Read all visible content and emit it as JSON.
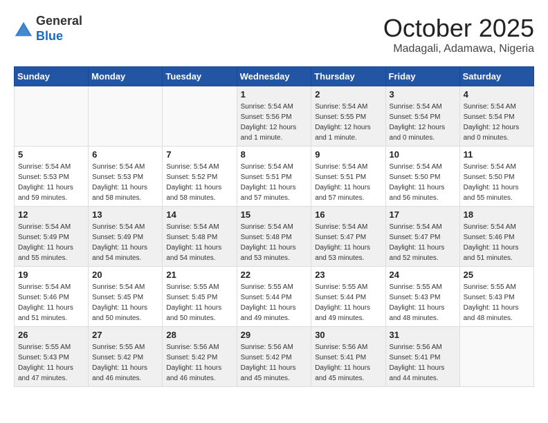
{
  "header": {
    "logo_general": "General",
    "logo_blue": "Blue",
    "month_title": "October 2025",
    "location": "Madagali, Adamawa, Nigeria"
  },
  "days_of_week": [
    "Sunday",
    "Monday",
    "Tuesday",
    "Wednesday",
    "Thursday",
    "Friday",
    "Saturday"
  ],
  "weeks": [
    [
      {
        "num": "",
        "info": "",
        "empty": true
      },
      {
        "num": "",
        "info": "",
        "empty": true
      },
      {
        "num": "",
        "info": "",
        "empty": true
      },
      {
        "num": "1",
        "info": "Sunrise: 5:54 AM\nSunset: 5:56 PM\nDaylight: 12 hours\nand 1 minute."
      },
      {
        "num": "2",
        "info": "Sunrise: 5:54 AM\nSunset: 5:55 PM\nDaylight: 12 hours\nand 1 minute."
      },
      {
        "num": "3",
        "info": "Sunrise: 5:54 AM\nSunset: 5:54 PM\nDaylight: 12 hours\nand 0 minutes."
      },
      {
        "num": "4",
        "info": "Sunrise: 5:54 AM\nSunset: 5:54 PM\nDaylight: 12 hours\nand 0 minutes."
      }
    ],
    [
      {
        "num": "5",
        "info": "Sunrise: 5:54 AM\nSunset: 5:53 PM\nDaylight: 11 hours\nand 59 minutes."
      },
      {
        "num": "6",
        "info": "Sunrise: 5:54 AM\nSunset: 5:53 PM\nDaylight: 11 hours\nand 58 minutes."
      },
      {
        "num": "7",
        "info": "Sunrise: 5:54 AM\nSunset: 5:52 PM\nDaylight: 11 hours\nand 58 minutes."
      },
      {
        "num": "8",
        "info": "Sunrise: 5:54 AM\nSunset: 5:51 PM\nDaylight: 11 hours\nand 57 minutes."
      },
      {
        "num": "9",
        "info": "Sunrise: 5:54 AM\nSunset: 5:51 PM\nDaylight: 11 hours\nand 57 minutes."
      },
      {
        "num": "10",
        "info": "Sunrise: 5:54 AM\nSunset: 5:50 PM\nDaylight: 11 hours\nand 56 minutes."
      },
      {
        "num": "11",
        "info": "Sunrise: 5:54 AM\nSunset: 5:50 PM\nDaylight: 11 hours\nand 55 minutes."
      }
    ],
    [
      {
        "num": "12",
        "info": "Sunrise: 5:54 AM\nSunset: 5:49 PM\nDaylight: 11 hours\nand 55 minutes."
      },
      {
        "num": "13",
        "info": "Sunrise: 5:54 AM\nSunset: 5:49 PM\nDaylight: 11 hours\nand 54 minutes."
      },
      {
        "num": "14",
        "info": "Sunrise: 5:54 AM\nSunset: 5:48 PM\nDaylight: 11 hours\nand 54 minutes."
      },
      {
        "num": "15",
        "info": "Sunrise: 5:54 AM\nSunset: 5:48 PM\nDaylight: 11 hours\nand 53 minutes."
      },
      {
        "num": "16",
        "info": "Sunrise: 5:54 AM\nSunset: 5:47 PM\nDaylight: 11 hours\nand 53 minutes."
      },
      {
        "num": "17",
        "info": "Sunrise: 5:54 AM\nSunset: 5:47 PM\nDaylight: 11 hours\nand 52 minutes."
      },
      {
        "num": "18",
        "info": "Sunrise: 5:54 AM\nSunset: 5:46 PM\nDaylight: 11 hours\nand 51 minutes."
      }
    ],
    [
      {
        "num": "19",
        "info": "Sunrise: 5:54 AM\nSunset: 5:46 PM\nDaylight: 11 hours\nand 51 minutes."
      },
      {
        "num": "20",
        "info": "Sunrise: 5:54 AM\nSunset: 5:45 PM\nDaylight: 11 hours\nand 50 minutes."
      },
      {
        "num": "21",
        "info": "Sunrise: 5:55 AM\nSunset: 5:45 PM\nDaylight: 11 hours\nand 50 minutes."
      },
      {
        "num": "22",
        "info": "Sunrise: 5:55 AM\nSunset: 5:44 PM\nDaylight: 11 hours\nand 49 minutes."
      },
      {
        "num": "23",
        "info": "Sunrise: 5:55 AM\nSunset: 5:44 PM\nDaylight: 11 hours\nand 49 minutes."
      },
      {
        "num": "24",
        "info": "Sunrise: 5:55 AM\nSunset: 5:43 PM\nDaylight: 11 hours\nand 48 minutes."
      },
      {
        "num": "25",
        "info": "Sunrise: 5:55 AM\nSunset: 5:43 PM\nDaylight: 11 hours\nand 48 minutes."
      }
    ],
    [
      {
        "num": "26",
        "info": "Sunrise: 5:55 AM\nSunset: 5:43 PM\nDaylight: 11 hours\nand 47 minutes."
      },
      {
        "num": "27",
        "info": "Sunrise: 5:55 AM\nSunset: 5:42 PM\nDaylight: 11 hours\nand 46 minutes."
      },
      {
        "num": "28",
        "info": "Sunrise: 5:56 AM\nSunset: 5:42 PM\nDaylight: 11 hours\nand 46 minutes."
      },
      {
        "num": "29",
        "info": "Sunrise: 5:56 AM\nSunset: 5:42 PM\nDaylight: 11 hours\nand 45 minutes."
      },
      {
        "num": "30",
        "info": "Sunrise: 5:56 AM\nSunset: 5:41 PM\nDaylight: 11 hours\nand 45 minutes."
      },
      {
        "num": "31",
        "info": "Sunrise: 5:56 AM\nSunset: 5:41 PM\nDaylight: 11 hours\nand 44 minutes."
      },
      {
        "num": "",
        "info": "",
        "empty": true
      }
    ]
  ]
}
